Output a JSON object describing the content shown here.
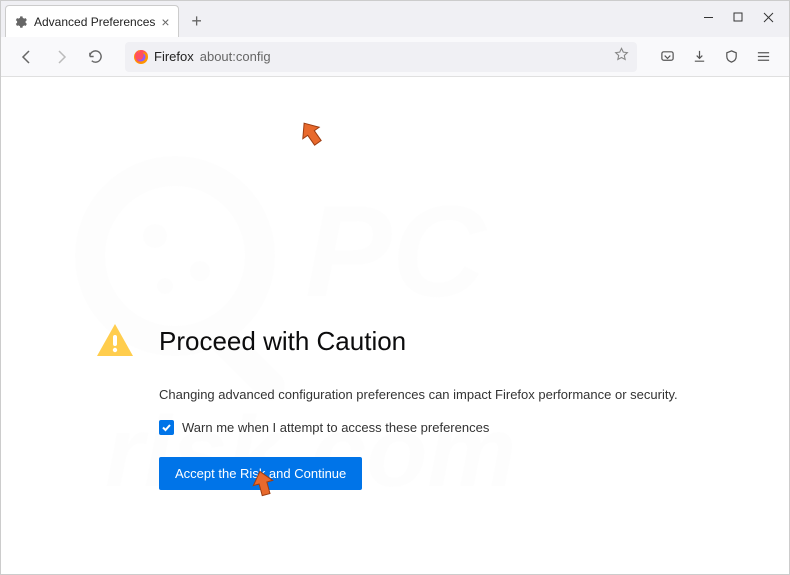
{
  "tab": {
    "title": "Advanced Preferences"
  },
  "url": {
    "app": "Firefox",
    "path": "about:config"
  },
  "warning": {
    "title": "Proceed with Caution",
    "desc": "Changing advanced configuration preferences can impact Firefox performance or security.",
    "checkbox": "Warn me when I attempt to access these preferences",
    "button": "Accept the Risk and Continue"
  }
}
